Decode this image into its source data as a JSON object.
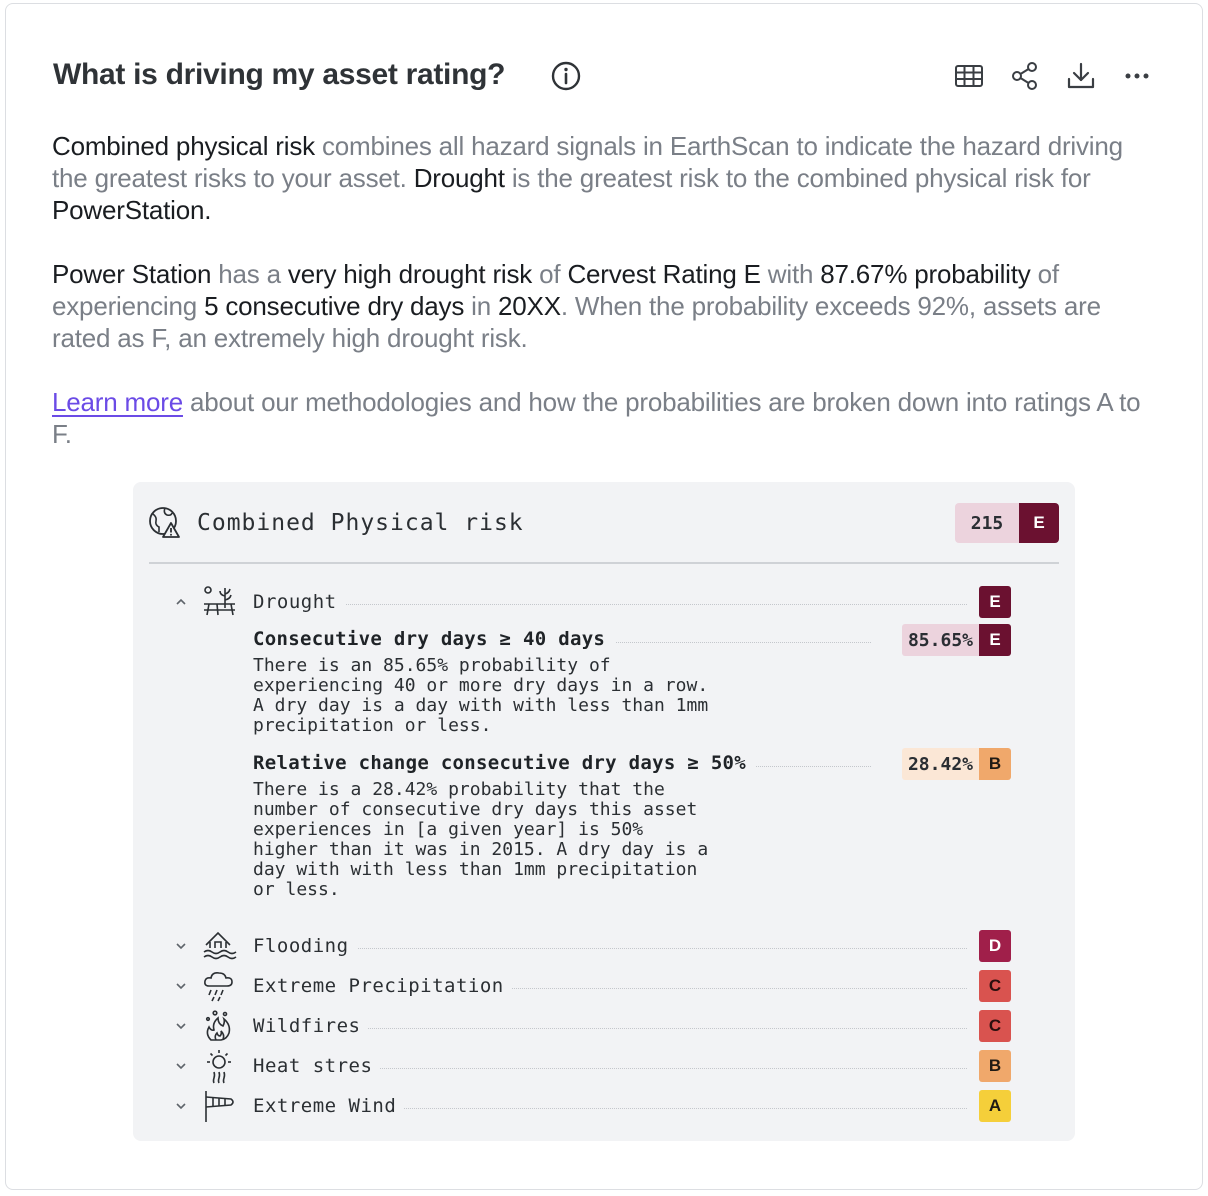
{
  "header": {
    "title": "What is driving my asset rating?",
    "info_icon": "info-circle-icon",
    "toolbar": [
      {
        "name": "table-view-button",
        "icon": "table-icon"
      },
      {
        "name": "share-button",
        "icon": "share-icon"
      },
      {
        "name": "download-button",
        "icon": "download-icon"
      },
      {
        "name": "more-button",
        "icon": "ellipsis-icon"
      }
    ]
  },
  "description": {
    "p1": {
      "a": "Combined physical risk",
      "b": " combines all hazard signals in EarthScan to indicate the hazard driving the greatest risks to your asset. ",
      "c": "Drought",
      "d": " is the greatest risk to the combined physical risk for ",
      "e": "PowerStation."
    },
    "p2": {
      "a": "Power Station",
      "b": " has a ",
      "c": "very high drought risk",
      "d": " of ",
      "e": "Cervest Rating E",
      "f": " with ",
      "g": "87.67% probability",
      "h": " of experiencing ",
      "i": "5 consecutive dry days",
      "j": " in ",
      "k": "20XX",
      "l": ". When the probability exceeds 92%, assets are rated as F, an extremely high drought risk."
    },
    "p3": {
      "link": "Learn more",
      "rest": " about our methodologies and how the probabilities are broken down into ratings A to  F."
    }
  },
  "panel": {
    "title": "Combined Physical risk",
    "score": "215",
    "grade": "E",
    "grade_color": "#6b1130",
    "score_bg": "#ecd3dd",
    "hazards": [
      {
        "label": "Drought",
        "grade": "E",
        "color": "#6b1130",
        "text_color": "#ffffff",
        "icon": "drought-icon",
        "expanded": true
      },
      {
        "label": "Flooding",
        "grade": "D",
        "color": "#a01f4a",
        "text_color": "#ffffff",
        "icon": "flooding-icon",
        "expanded": false
      },
      {
        "label": "Extreme Precipitation",
        "grade": "C",
        "color": "#d9534f",
        "text_color": "#2b0f0f",
        "icon": "precipitation-icon",
        "expanded": false
      },
      {
        "label": "Wildfires",
        "grade": "C",
        "color": "#d9534f",
        "text_color": "#2b0f0f",
        "icon": "wildfire-icon",
        "expanded": false
      },
      {
        "label": "Heat stres",
        "grade": "B",
        "color": "#f0a86b",
        "text_color": "#1f1a14",
        "icon": "heat-icon",
        "expanded": false
      },
      {
        "label": "Extreme Wind",
        "grade": "A",
        "color": "#f5cf3a",
        "text_color": "#1f1a14",
        "icon": "wind-icon",
        "expanded": false
      }
    ],
    "drought_metrics": [
      {
        "title": "Consecutive dry days ≥ 40 days",
        "percent": "85.65%",
        "grade": "E",
        "pct_bg": "#ecd3dd",
        "grade_bg": "#6b1130",
        "grade_text": "#ffffff",
        "text": "There is an 85.65% probability of\nexperiencing 40 or more dry days in a row.\nA dry day is a day with with less than 1mm\nprecipitation or less."
      },
      {
        "title": "Relative change consecutive dry days ≥ 50%",
        "percent": "28.42%",
        "grade": "B",
        "pct_bg": "#fbe7d6",
        "grade_bg": "#f0a86b",
        "grade_text": "#1f1a14",
        "text": "There is a 28.42% probability that the\nnumber of consecutive dry days this asset\nexperiences in [a given year] is 50%\nhigher than it was in 2015. A dry day is a\nday with with less than 1mm precipitation\nor less."
      }
    ]
  }
}
